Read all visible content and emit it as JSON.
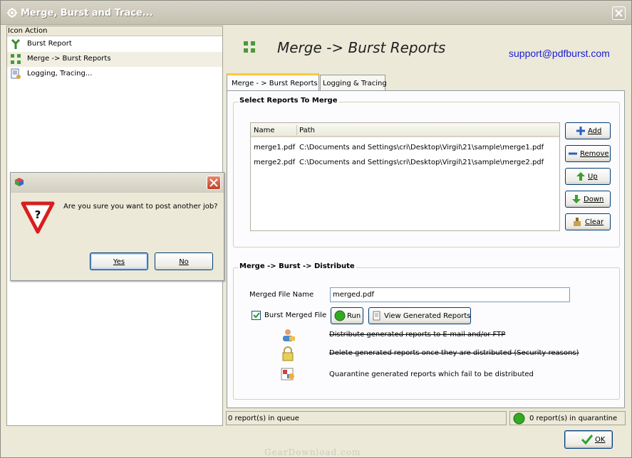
{
  "window": {
    "title": "Merge, Burst and Trace..."
  },
  "left_panel": {
    "header": "Icon Action",
    "items": [
      {
        "label": "Burst Report",
        "icon": "burst-icon"
      },
      {
        "label": "Merge -> Burst Reports",
        "icon": "merge-icon",
        "selected": true
      },
      {
        "label": "Logging, Tracing...",
        "icon": "log-icon"
      }
    ]
  },
  "header": {
    "title": "Merge -> Burst Reports",
    "support": "support@pdfburst.com"
  },
  "tabs": [
    {
      "label": "Merge - > Burst Reports",
      "active": true
    },
    {
      "label": "Logging & Tracing",
      "active": false
    }
  ],
  "select_group": {
    "title": "Select Reports To Merge",
    "columns": [
      "Name",
      "Path"
    ],
    "rows": [
      {
        "name": "merge1.pdf",
        "path": "C:\\Documents and Settings\\cri\\Desktop\\Virgil\\21\\sample\\merge1.pdf"
      },
      {
        "name": "merge2.pdf",
        "path": "C:\\Documents and Settings\\cri\\Desktop\\Virgil\\21\\sample\\merge2.pdf"
      }
    ],
    "buttons": {
      "add": "Add",
      "remove": "Remove",
      "up": "Up",
      "down": "Down",
      "clear": "Clear"
    }
  },
  "distribute_group": {
    "title": "Merge -> Burst -> Distribute",
    "merged_file_label": "Merged File Name",
    "merged_file_value": "merged.pdf",
    "burst_checkbox_label": "Burst Merged File",
    "burst_checked": true,
    "run_label": "Run",
    "view_label": "View Generated Reports",
    "options": [
      {
        "text": "Distribute generated reports to E-mail and/or FTP",
        "strikethrough": true
      },
      {
        "text": "Delete generated reports once they are distributed (Security reasons)",
        "strikethrough": true
      },
      {
        "text": "Quarantine generated reports which fail to be distributed",
        "strikethrough": false
      }
    ]
  },
  "status": {
    "queue": "0 report(s) in queue",
    "quarantine": "0 report(s) in quarantine"
  },
  "ok_label": "OK",
  "watermark": "GearDownload.com",
  "dialog": {
    "message": "Are you sure you want to post another job?",
    "yes_label": "Yes",
    "no_label": "No"
  },
  "colors": {
    "accent_tab": "#ffc83c",
    "link": "#1b1bd6",
    "status_ok": "#33aa22"
  }
}
